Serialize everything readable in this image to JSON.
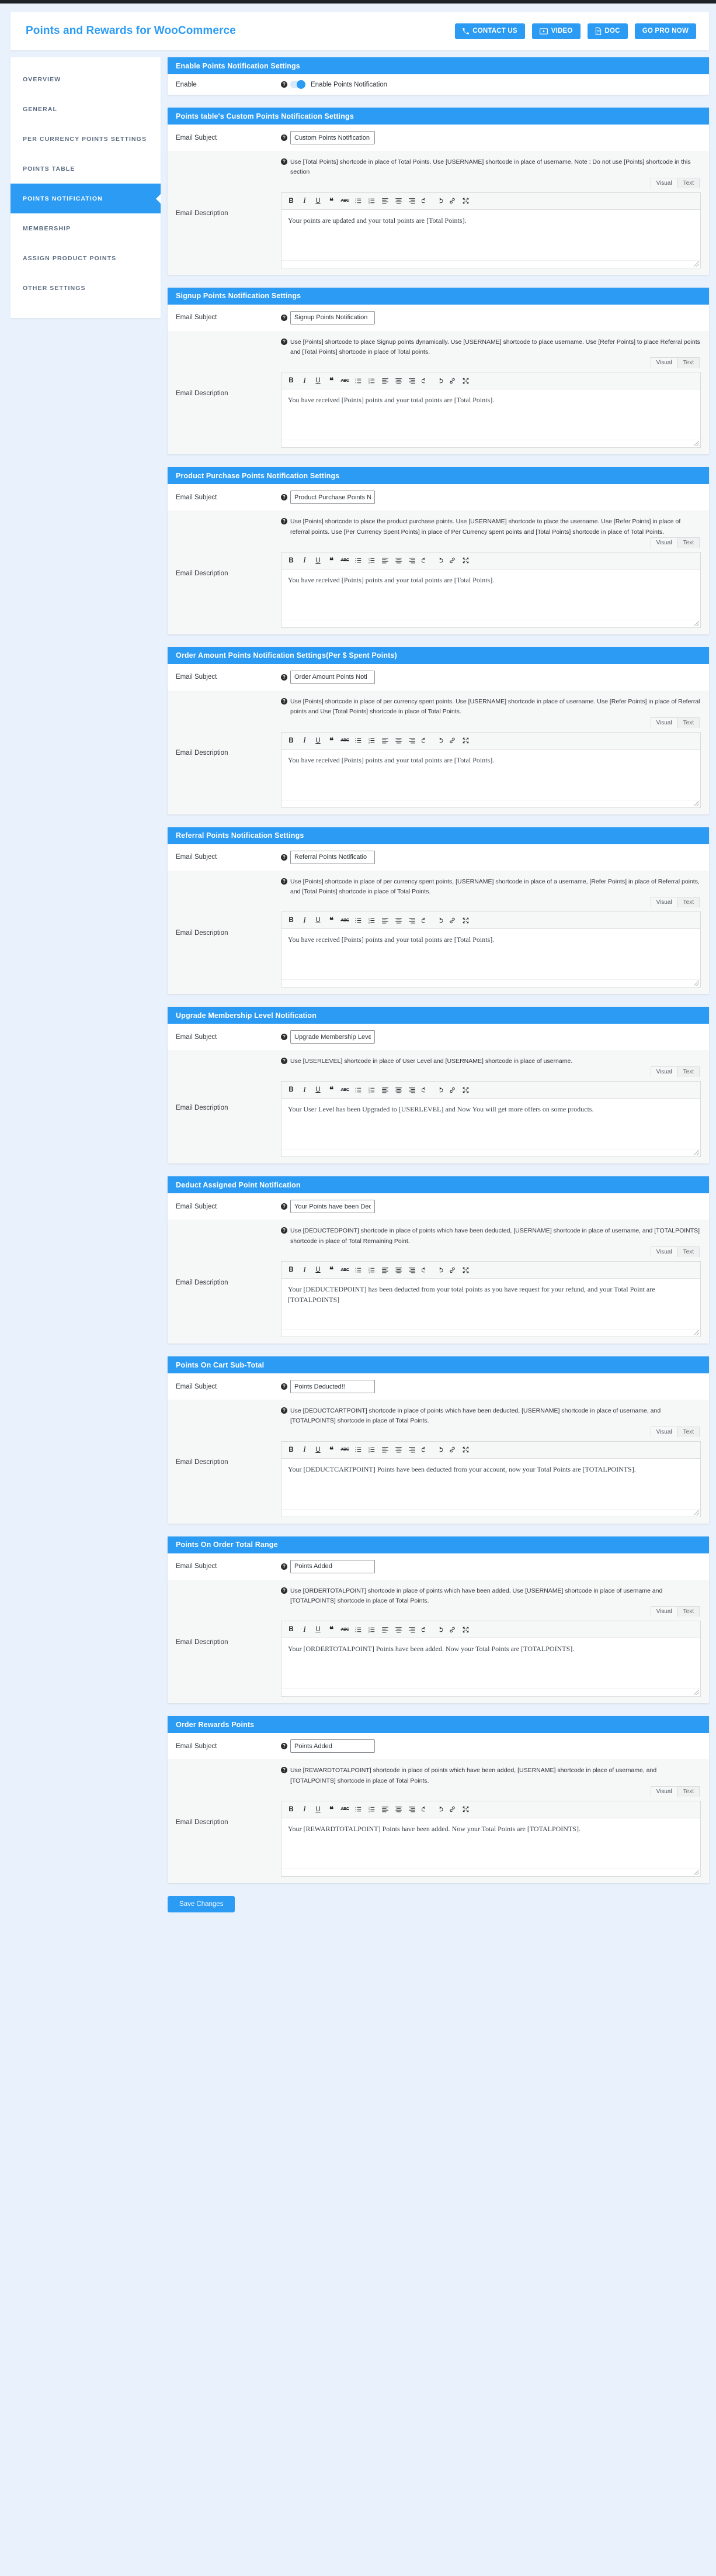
{
  "header": {
    "title": "Points and Rewards for WooCommerce",
    "buttons": [
      {
        "label": "CONTACT US",
        "icon": "phone-icon"
      },
      {
        "label": "VIDEO",
        "icon": "play-icon"
      },
      {
        "label": "DOC",
        "icon": "document-icon"
      },
      {
        "label": "GO PRO NOW",
        "icon": "none"
      }
    ]
  },
  "sidebar": {
    "items": [
      {
        "label": "OVERVIEW",
        "active": false
      },
      {
        "label": "GENERAL",
        "active": false
      },
      {
        "label": "PER CURRENCY POINTS SETTINGS",
        "active": false
      },
      {
        "label": "POINTS TABLE",
        "active": false
      },
      {
        "label": "POINTS NOTIFICATION",
        "active": true
      },
      {
        "label": "MEMBERSHIP",
        "active": false
      },
      {
        "label": "ASSIGN PRODUCT POINTS",
        "active": false
      },
      {
        "label": "OTHER SETTINGS",
        "active": false
      }
    ]
  },
  "labels": {
    "email_subject": "Email Subject",
    "email_description": "Email Description",
    "enable": "Enable",
    "visual_tab": "Visual",
    "text_tab": "Text",
    "save_changes": "Save Changes"
  },
  "toolbar_icons": [
    "bold-icon",
    "italic-icon",
    "underline-icon",
    "blockquote-icon",
    "strikethrough-icon",
    "bulleted-list-icon",
    "numbered-list-icon",
    "align-left-icon",
    "align-center-icon",
    "align-right-icon",
    "undo-icon",
    "redo-icon",
    "link-icon",
    "fullscreen-icon"
  ],
  "enable_panel": {
    "title": "Enable Points Notification Settings",
    "toggle_label": "Enable Points Notification",
    "toggle_on": true
  },
  "panels": [
    {
      "title": "Points table's Custom Points Notification Settings",
      "subject": "Custom Points Notification",
      "hint": "Use [Total Points] shortcode in place of Total Points. Use [USERNAME] shortcode in place of username. Note : Do not use [Points] shortcode in this section",
      "description": "Your points are updated and your total points are [Total Points]."
    },
    {
      "title": "Signup Points Notification Settings",
      "subject": "Signup Points Notification",
      "hint": "Use [Points] shortcode to place Signup points dynamically. Use [USERNAME] shortcode to place username. Use [Refer Points] to place Referral points and [Total Points] shortcode in place of Total points.",
      "description": "You have received [Points] points and your total points are [Total Points]."
    },
    {
      "title": "Product Purchase Points Notification Settings",
      "subject": "Product Purchase Points N",
      "hint": "Use [Points] shortcode to place the product purchase points. Use [USERNAME] shortcode to place the username. Use [Refer Points] in place of referral points. Use [Per Currency Spent Points] in place of Per Currency spent points and [Total Points] shortcode in place of Total Points.",
      "description": "You have received [Points] points and your total points are [Total Points]."
    },
    {
      "title": "Order Amount Points Notification Settings(Per $ Spent Points)",
      "subject": "Order Amount Points Noti",
      "hint": "Use [Points] shortcode in place of per currency spent points. Use [USERNAME] shortcode in place of username. Use [Refer Points] in place of Referral points and Use [Total Points] shortcode in place of Total Points.",
      "description": "You have received [Points] points and your total points are [Total Points]."
    },
    {
      "title": "Referral Points Notification Settings",
      "subject": "Referral Points Notificatio",
      "hint": "Use [Points] shortcode in place of per currency spent points, [USERNAME] shortcode in place of a username, [Refer Points] in place of Referral points, and [Total Points] shortcode in place of Total Points.",
      "description": "You have received [Points] points and your total points are [Total Points]."
    },
    {
      "title": "Upgrade Membership Level Notification",
      "subject": "Upgrade Membership Leve",
      "hint": "Use [USERLEVEL] shortcode in place of User Level and [USERNAME] shortcode in place of username.",
      "description": "Your User Level has been Upgraded to [USERLEVEL] and Now You will get more offers on some products."
    },
    {
      "title": "Deduct Assigned Point Notification",
      "subject": "Your Points have been Dec",
      "hint": "Use [DEDUCTEDPOINT] shortcode in place of points which have been deducted, [USERNAME] shortcode in place of username, and [TOTALPOINTS] shortcode in place of Total Remaining Point.",
      "description": "Your [DEDUCTEDPOINT] has been deducted from your total points as you have request for your refund, and your Total Point are [TOTALPOINTS]"
    },
    {
      "title": "Points On Cart Sub-Total",
      "subject": "Points Deducted!!",
      "hint": "Use [DEDUCTCARTPOINT] shortcode in place of points which have been deducted, [USERNAME] shortcode in place of username, and [TOTALPOINTS] shortcode in place of Total Points.",
      "description": "Your [DEDUCTCARTPOINT] Points have been deducted from your account, now your Total Points are [TOTALPOINTS]."
    },
    {
      "title": "Points On Order Total Range",
      "subject": "Points Added",
      "hint": "Use [ORDERTOTALPOINT] shortcode in place of points which have been added. Use [USERNAME] shortcode in place of username and [TOTALPOINTS] shortcode in place of Total Points.",
      "description": "Your [ORDERTOTALPOINT] Points have been added. Now your Total Points are [TOTALPOINTS]."
    },
    {
      "title": "Order Rewards Points",
      "subject": "Points Added",
      "hint": "Use [REWARDTOTALPOINT] shortcode in place of points which have been added, [USERNAME] shortcode in place of username, and [TOTALPOINTS] shortcode in place of Total Points.",
      "description": "Your [REWARDTOTALPOINT] Points have been added. Now your Total Points are [TOTALPOINTS]."
    }
  ]
}
